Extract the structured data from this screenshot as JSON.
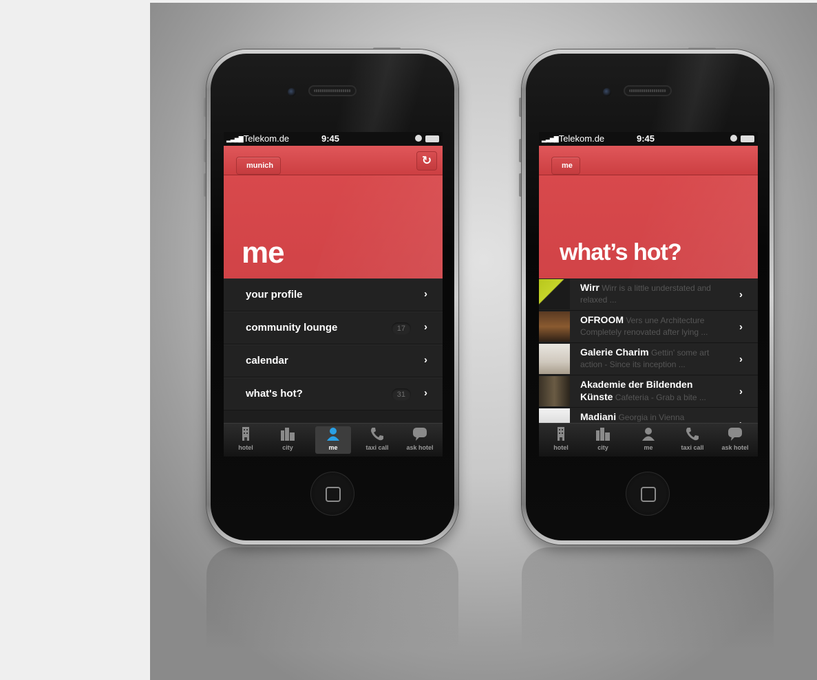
{
  "phone_left": {
    "status": {
      "carrier": "Telekom.de",
      "time": "9:45"
    },
    "nav": {
      "back_label": "munich"
    },
    "hero_title": "me",
    "menu": [
      {
        "label": "your profile",
        "badge": ""
      },
      {
        "label": "community lounge",
        "badge": "17"
      },
      {
        "label": "calendar",
        "badge": ""
      },
      {
        "label": "what's hot?",
        "badge": "31"
      }
    ],
    "tabs": [
      {
        "label": "hotel",
        "icon": "hotel-icon",
        "active": false
      },
      {
        "label": "city",
        "icon": "city-icon",
        "active": false
      },
      {
        "label": "me",
        "icon": "person-icon",
        "active": true
      },
      {
        "label": "taxi call",
        "icon": "phone-icon",
        "active": false
      },
      {
        "label": "ask hotel",
        "icon": "chat-bubble-icon",
        "active": false
      }
    ]
  },
  "phone_right": {
    "status": {
      "carrier": "Telekom.de",
      "time": "9:45"
    },
    "nav": {
      "back_label": "me"
    },
    "hero_title": "what’s hot?",
    "items": [
      {
        "name": "Wirr",
        "desc": "Wirr is a little understated and relaxed ..."
      },
      {
        "name": "OFROOM",
        "desc": "Vers une Architecture Completely renovated after lying ..."
      },
      {
        "name": "Galerie Charim",
        "desc": "Gettin' some art action - Since its inception ..."
      },
      {
        "name": "Akademie der Bildenden Künste",
        "desc": "Cafeteria - Grab a bite ..."
      },
      {
        "name": "Madiani",
        "desc": "Georgia in Vienna"
      }
    ],
    "tabs": [
      {
        "label": "hotel",
        "icon": "hotel-icon",
        "active": false
      },
      {
        "label": "city",
        "icon": "city-icon",
        "active": false
      },
      {
        "label": "me",
        "icon": "person-icon",
        "active": false
      },
      {
        "label": "taxi call",
        "icon": "phone-icon",
        "active": false
      },
      {
        "label": "ask hotel",
        "icon": "chat-bubble-icon",
        "active": false
      }
    ]
  },
  "colors": {
    "accent_red": "#d4474a",
    "tab_active_blue": "#2aa0e6",
    "dark_row": "#222222"
  }
}
